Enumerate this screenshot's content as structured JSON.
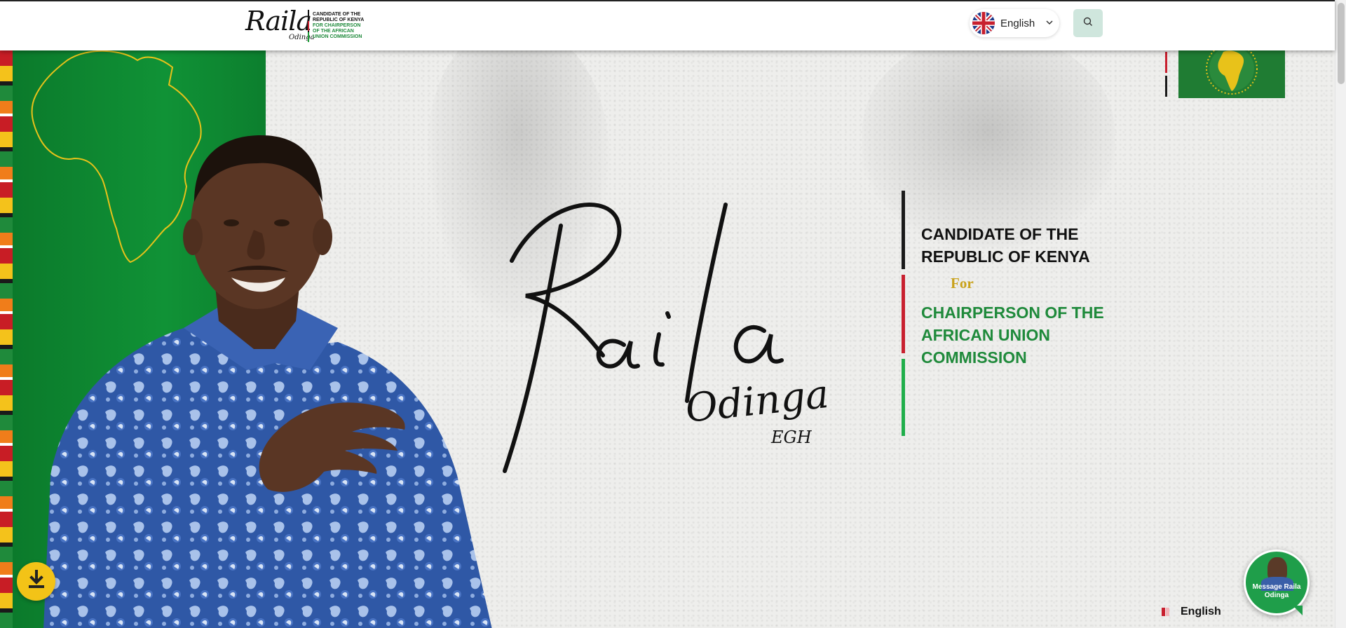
{
  "header": {
    "logo": {
      "script": "Raila",
      "script_small": "Odinga",
      "tag_line1": "CANDIDATE OF THE REPUBLIC OF KENYA",
      "tag_line2": "FOR CHAIRPERSON OF THE AFRICAN UNION COMMISSION"
    },
    "language": {
      "label": "English",
      "flag_icon": "uk-flag-icon",
      "chevron_icon": "chevron-down-icon"
    },
    "search": {
      "icon": "search-icon"
    }
  },
  "hero": {
    "signature": {
      "first": "Raila",
      "last": "Odinga",
      "suffix": "EGH"
    },
    "tagline": {
      "line1": "CANDIDATE OF THE REPUBLIC OF KENYA",
      "for": "For",
      "line2": "CHAIRPERSON OF THE AFRICAN UNION COMMISSION"
    },
    "download": {
      "icon": "download-icon"
    },
    "message": {
      "label": "Message Raila Odinga"
    },
    "language_footer": {
      "label": "English",
      "flag_icon": "kenya-flag-icon"
    }
  },
  "colors": {
    "green": "#109236",
    "accent_green_text": "#1f8a3b",
    "red": "#c8202f",
    "gold": "#c9a21a",
    "yellow": "#f3c317",
    "search_bg": "#cfe6dd"
  }
}
